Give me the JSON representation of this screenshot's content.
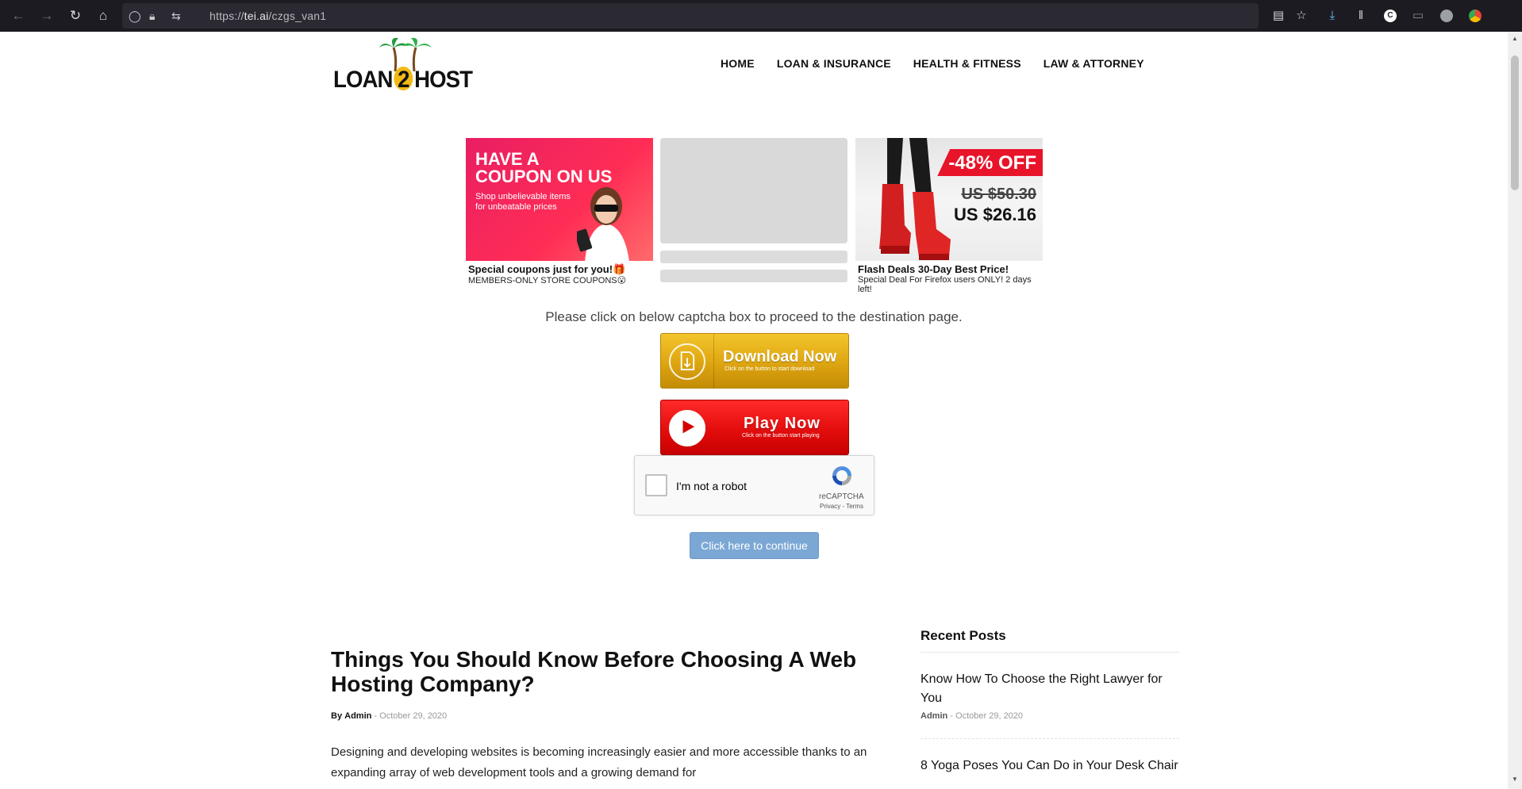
{
  "browser": {
    "url_prefix": "https://",
    "url_domain": "tei.ai",
    "url_path": "/czgs_van1"
  },
  "site": {
    "logo_left": "LOAN",
    "logo_num": "2",
    "logo_right": "HOST",
    "nav": [
      "HOME",
      "LOAN & INSURANCE",
      "HEALTH & FITNESS",
      "LAW & ATTORNEY"
    ]
  },
  "ads": {
    "coupon": {
      "headline1": "HAVE A",
      "headline2": "COUPON ON US",
      "sub1": "Shop unbelievable items",
      "sub2": "for unbeatable prices",
      "title": "Special coupons just for you!🎁",
      "subtitle": "MEMBERS-ONLY STORE COUPONS😮"
    },
    "deal": {
      "discount": "-48% OFF",
      "old_price": "US $50.30",
      "new_price": "US $26.16",
      "title": "Flash Deals 30-Day Best Price!",
      "subtitle": "Special Deal For Firefox users ONLY! 2 days left!"
    }
  },
  "instruction": "Please click on below captcha box to proceed to the destination page.",
  "download_btn": {
    "label": "Download Now",
    "sub": "Click on the button to start download"
  },
  "play_btn": {
    "label": "Play Now",
    "sub": "Click on the button start playing"
  },
  "recaptcha": {
    "label": "I'm not a robot",
    "brand": "reCAPTCHA",
    "links": "Privacy - Terms"
  },
  "continue_label": "Click here to continue",
  "article": {
    "title": "Things You Should Know Before Choosing A Web Hosting Company?",
    "by": "By",
    "author": "Admin",
    "date": "October 29, 2020",
    "excerpt": "Designing and developing websites is becoming increasingly easier and more accessible thanks to an expanding array of web development tools and a growing demand for"
  },
  "sidebar": {
    "heading": "Recent Posts",
    "posts": [
      {
        "title": "Know How To Choose the Right Lawyer for You",
        "author": "Admin",
        "date": "October 29, 2020"
      },
      {
        "title": "8 Yoga Poses You Can Do in Your Desk Chair",
        "author": "",
        "date": ""
      }
    ]
  },
  "colors": {
    "chrome_bg": "#1c1b22",
    "urlbar_bg": "#2b2a33",
    "download_gold": "#e0a812",
    "play_red": "#e30d0d",
    "continue_blue": "#7ba7d4"
  }
}
